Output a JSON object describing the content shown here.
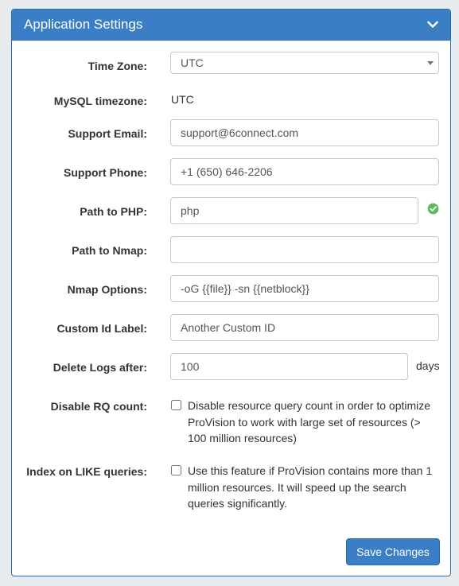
{
  "panel": {
    "title": "Application Settings",
    "collapse_icon": "chevron-down-icon"
  },
  "settings": {
    "time_zone": {
      "label": "Time Zone:",
      "value": "UTC"
    },
    "mysql_timezone": {
      "label": "MySQL timezone:",
      "value": "UTC"
    },
    "support_email": {
      "label": "Support Email:",
      "value": "support@6connect.com"
    },
    "support_phone": {
      "label": "Support Phone:",
      "value": "+1 (650) 646-2206"
    },
    "path_to_php": {
      "label": "Path to PHP:",
      "value": "php",
      "status_icon": "check-circle-icon",
      "status_color": "#5cb85c"
    },
    "path_to_nmap": {
      "label": "Path to Nmap:",
      "value": ""
    },
    "nmap_options": {
      "label": "Nmap Options:",
      "value": "-oG {{file}} -sn {{netblock}}"
    },
    "custom_id_label": {
      "label": "Custom Id Label:",
      "placeholder": "Another Custom ID"
    },
    "delete_logs_after": {
      "label": "Delete Logs after:",
      "value": "100",
      "suffix": "days"
    },
    "disable_rq_count": {
      "label": "Disable RQ count:",
      "checked": false,
      "description": "Disable resource query count in order to optimize ProVision to work with large set of resources (> 100 million resources)"
    },
    "index_on_like": {
      "label": "Index on LIKE queries:",
      "checked": false,
      "description": "Use this feature if ProVision contains more than 1 million resources. It will speed up the search queries significantly."
    }
  },
  "actions": {
    "save_label": "Save Changes"
  },
  "colors": {
    "header_bg": "#3a7fc6",
    "border": "#2e6da4",
    "button_bg": "#3a7fc6"
  }
}
